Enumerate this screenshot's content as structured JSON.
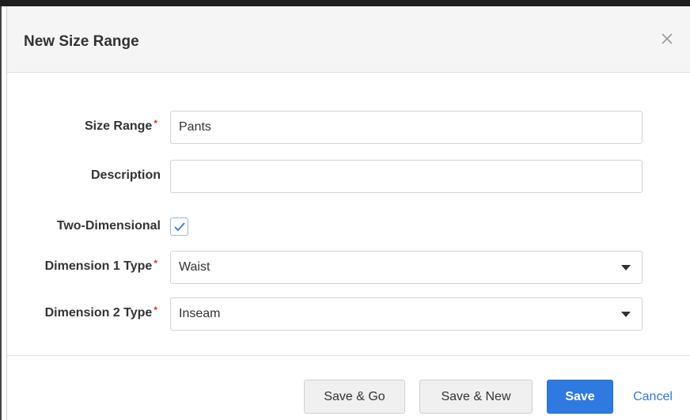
{
  "dialog": {
    "title": "New Size Range",
    "close_glyph": "×"
  },
  "form": {
    "size_range": {
      "label": "Size Range",
      "required": "*",
      "value": "Pants",
      "placeholder": ""
    },
    "description": {
      "label": "Description",
      "value": "",
      "placeholder": ""
    },
    "two_dimensional": {
      "label": "Two-Dimensional",
      "checked": true
    },
    "dimension1": {
      "label": "Dimension 1 Type",
      "required": "*",
      "value": "Waist"
    },
    "dimension2": {
      "label": "Dimension 2 Type",
      "required": "*",
      "value": "Inseam"
    }
  },
  "footer": {
    "save_go": "Save & Go",
    "save_new": "Save & New",
    "save": "Save",
    "cancel": "Cancel"
  },
  "icons": {
    "close": "close-icon",
    "check": "check-icon",
    "caret": "caret-down-icon"
  },
  "colors": {
    "primary": "#2f7ae0",
    "required": "#e03131",
    "checkbox_border": "#9bb6d9"
  }
}
